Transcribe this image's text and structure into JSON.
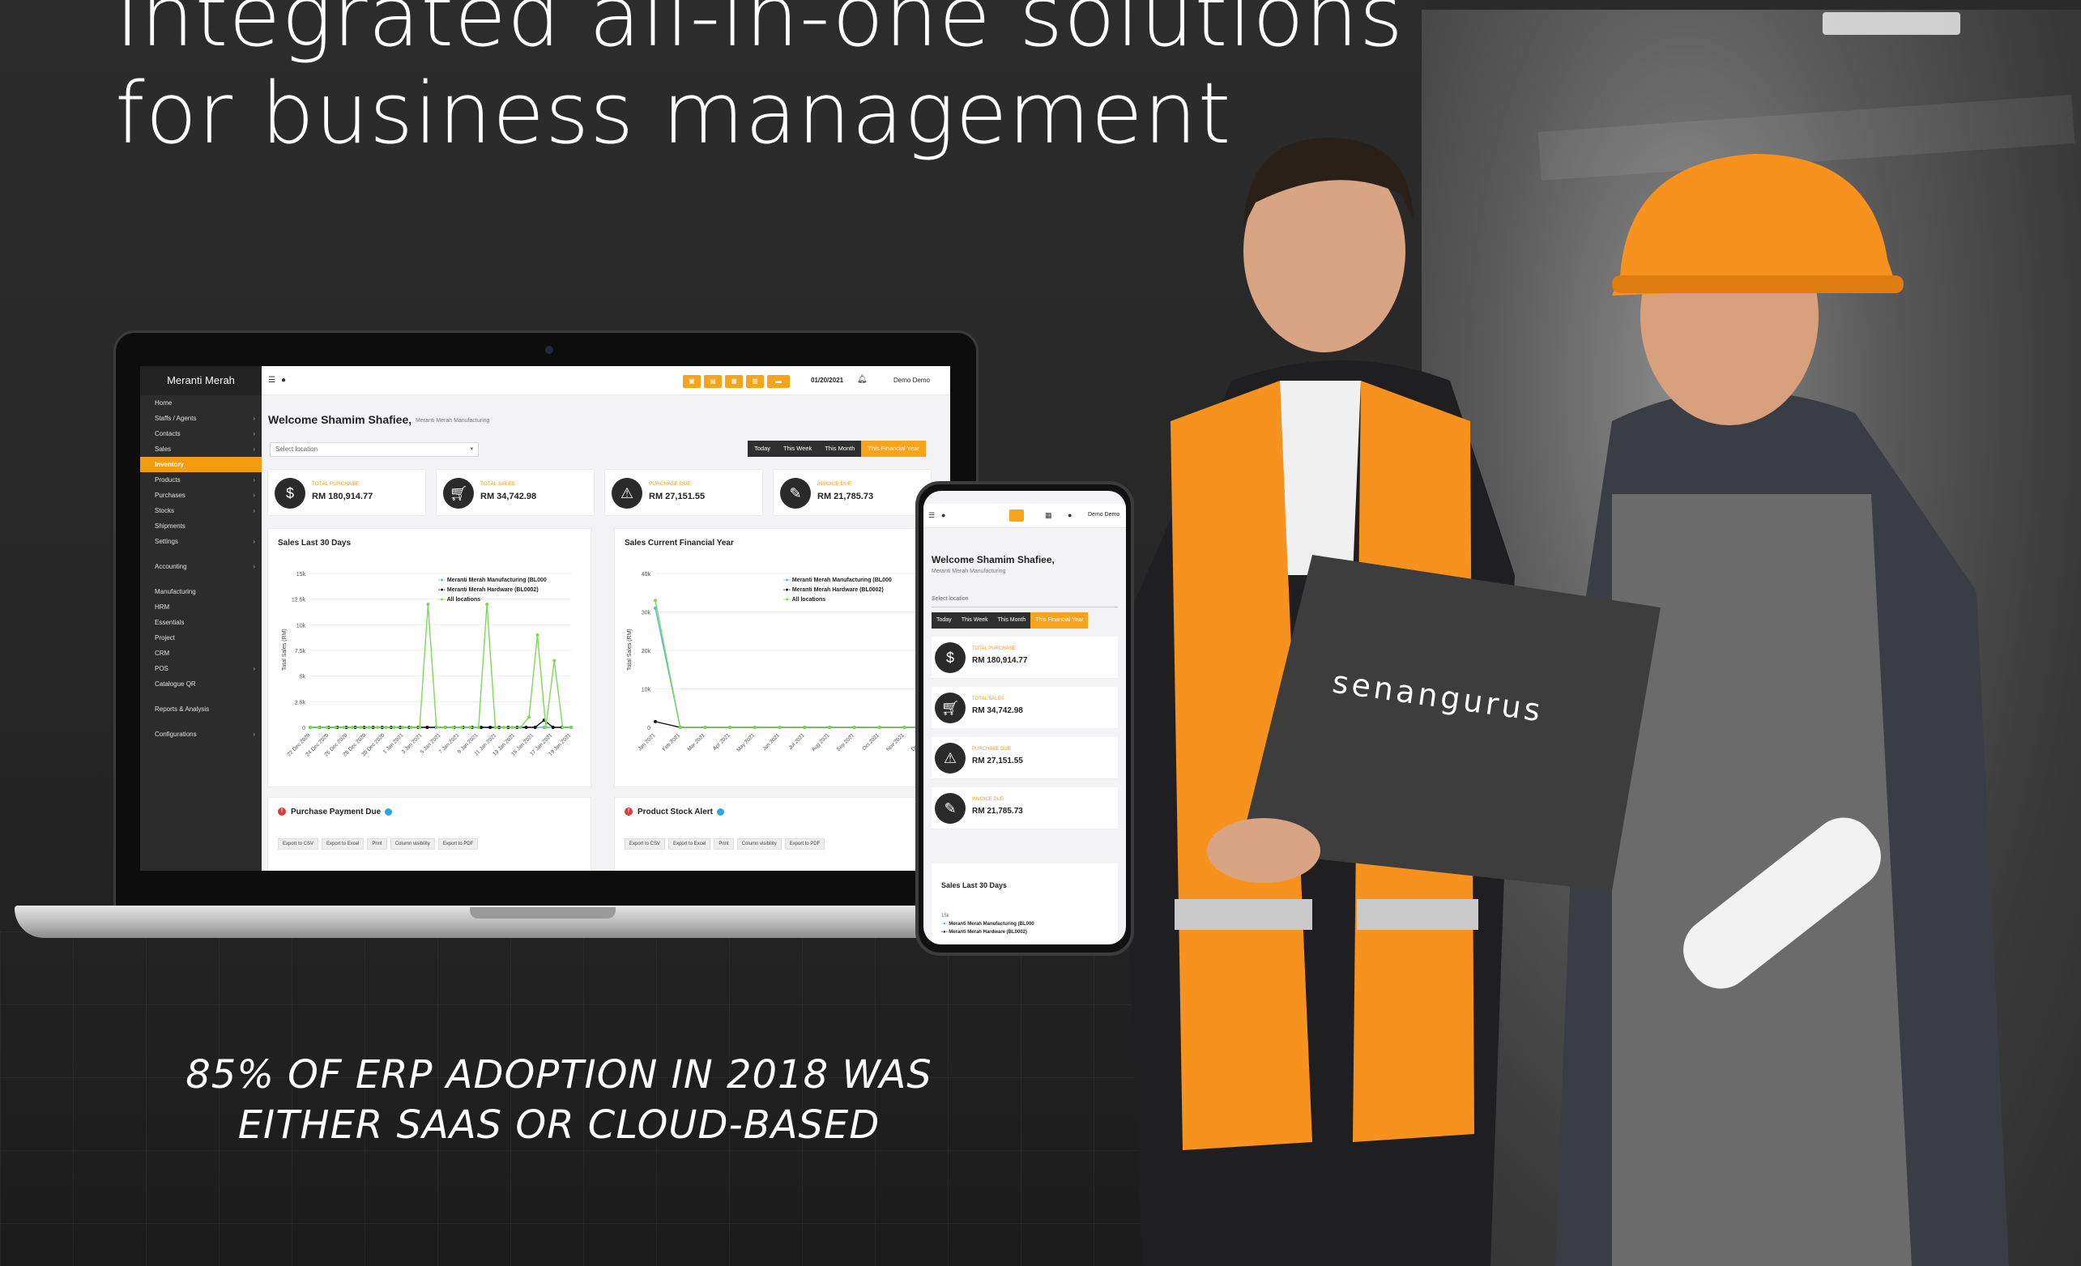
{
  "headline": {
    "line1": "Integrated all-in-one solutions",
    "line2": "for business management"
  },
  "stat": {
    "line1": "85% OF ERP ADOPTION IN 2018 WAS",
    "line2": "EITHER SAAS OR CLOUD-BASED"
  },
  "brand_logo": "senangurus",
  "colors": {
    "accent": "#f7a31b",
    "dark": "#2c2c2c",
    "green": "#7ed957"
  },
  "desktop": {
    "sidebar": {
      "brand": "Meranti Merah",
      "items": [
        {
          "label": "Home",
          "icon": "home-icon",
          "chevron": false
        },
        {
          "label": "Staffs / Agents",
          "icon": "users-icon",
          "chevron": true
        },
        {
          "label": "Contacts",
          "icon": "contacts-icon",
          "chevron": true
        },
        {
          "label": "Sales",
          "icon": "cart-icon",
          "chevron": true
        },
        {
          "label": "Inventory",
          "icon": "dollar-icon",
          "chevron": true,
          "active": true
        },
        {
          "label": "Products",
          "icon": "",
          "chevron": true
        },
        {
          "label": "Purchases",
          "icon": "",
          "chevron": true
        },
        {
          "label": "Stocks",
          "icon": "",
          "chevron": true
        },
        {
          "label": "Shipments",
          "icon": "",
          "chevron": false
        },
        {
          "label": "Settings",
          "icon": "",
          "chevron": true
        },
        {
          "label": "Accounting",
          "icon": "ledger-icon",
          "chevron": true
        },
        {
          "label": "Manufacturing",
          "icon": "gear-icon",
          "chevron": false
        },
        {
          "label": "HRM",
          "icon": "users-icon",
          "chevron": false
        },
        {
          "label": "Essentials",
          "icon": "chat-icon",
          "chevron": false
        },
        {
          "label": "Project",
          "icon": "folder-icon",
          "chevron": false
        },
        {
          "label": "CRM",
          "icon": "globe-icon",
          "chevron": false
        },
        {
          "label": "POS",
          "icon": "chat-icon",
          "chevron": true
        },
        {
          "label": "Catalogue QR",
          "icon": "grid-icon",
          "chevron": false
        },
        {
          "label": "Reports & Analysis",
          "icon": "chart-icon",
          "chevron": false
        },
        {
          "label": "Configurations",
          "icon": "gear-icon",
          "chevron": true
        }
      ]
    },
    "topbar": {
      "date": "01/20/2021",
      "user": "Demo Demo"
    },
    "welcome": "Welcome Shamim Shafiee,",
    "welcome_sub": "Meranti Merah Manufacturing",
    "location_placeholder": "Select location",
    "periods": [
      "Today",
      "This Week",
      "This Month",
      "This Financial Year"
    ],
    "kpis": [
      {
        "label": "TOTAL PURCHASE",
        "value": "RM 180,914.77",
        "icon": "$"
      },
      {
        "label": "TOTAL SALES",
        "value": "RM 34,742.98",
        "icon": "cart"
      },
      {
        "label": "PURCHASE DUE",
        "value": "RM 27,151.55",
        "icon": "!"
      },
      {
        "label": "INVOICE DUE",
        "value": "RM 21,785.73",
        "icon": "clip"
      }
    ],
    "panels": {
      "sales30": "Sales Last 30 Days",
      "salesfy": "Sales Current Financial Year",
      "purchase_due": "Purchase Payment Due",
      "stock_alert": "Product Stock Alert",
      "export_buttons": [
        "Export to CSV",
        "Export to Excel",
        "Print",
        "Column visibility",
        "Export to PDF"
      ]
    },
    "legend": [
      "Meranti Merah Manufacturing (BL000",
      "Meranti Merah Hardware (BL0002)",
      "All locations"
    ]
  },
  "mobile": {
    "user": "Demo Demo",
    "welcome": "Welcome Shamim Shafiee,",
    "welcome_sub": "Meranti Merah Manufacturing",
    "location_placeholder": "Select location",
    "periods": [
      "Today",
      "This Week",
      "This Month",
      "This Financial Year"
    ],
    "chart_title": "Sales Last 30 Days",
    "chart_tick_top": "15k",
    "legend": [
      "Meranti Merah Manufacturing (BL000",
      "Meranti Merah Hardware (BL0002)"
    ]
  },
  "chart_data": [
    {
      "type": "line",
      "title": "Sales Last 30 Days",
      "ylabel": "Total Sales (RM)",
      "ylim": [
        0,
        15000
      ],
      "yticks": [
        "0",
        "2.5k",
        "5k",
        "7.5k",
        "10k",
        "12.5k",
        "15k"
      ],
      "x": [
        "22 Dec 2020",
        "24 Dec 2020",
        "26 Dec 2020",
        "28 Dec 2020",
        "30 Dec 2020",
        "1 Jan 2021",
        "3 Jan 2021",
        "5 Jan 2021",
        "7 Jan 2021",
        "9 Jan 2021",
        "11 Jan 2021",
        "13 Jan 2021",
        "15 Jan 2021",
        "17 Jan 2021",
        "19 Jan 2021"
      ],
      "series": [
        {
          "name": "Meranti Merah Manufacturing (BL000",
          "color": "#5fb3e8",
          "values": [
            0,
            0,
            0,
            0,
            0,
            0,
            0,
            0,
            0,
            0,
            0,
            0,
            0,
            0,
            0,
            0,
            0,
            0,
            0,
            0,
            0,
            0,
            0,
            0,
            0,
            0,
            0,
            0,
            0,
            0
          ]
        },
        {
          "name": "Meranti Merah Hardware (BL0002)",
          "color": "#111111",
          "values": [
            0,
            0,
            0,
            0,
            0,
            0,
            0,
            0,
            0,
            0,
            0,
            0,
            0,
            0,
            0,
            0,
            0,
            0,
            0,
            0,
            0,
            0,
            0,
            0,
            0,
            0,
            700,
            0,
            0,
            0
          ]
        },
        {
          "name": "All locations",
          "color": "#7ed957",
          "values": [
            0,
            0,
            0,
            0,
            0,
            0,
            0,
            0,
            0,
            0,
            0,
            0,
            0,
            0,
            12000,
            0,
            0,
            0,
            0,
            0,
            0,
            12000,
            0,
            0,
            0,
            0,
            1000,
            9000,
            0,
            6500,
            0,
            0
          ]
        }
      ]
    },
    {
      "type": "line",
      "title": "Sales Current Financial Year",
      "ylabel": "Total Sales (RM)",
      "ylim": [
        0,
        40000
      ],
      "yticks": [
        "0",
        "10k",
        "20k",
        "30k",
        "40k"
      ],
      "x": [
        "Jan 2021",
        "Feb 2021",
        "Mar 2021",
        "Apr 2021",
        "May 2021",
        "Jun 2021",
        "Jul 2021",
        "Aug 2021",
        "Sep 2021",
        "Oct 2021",
        "Nov 2021",
        "Dec 2021"
      ],
      "series": [
        {
          "name": "Meranti Merah Manufacturing (BL000",
          "color": "#5fb3e8",
          "values": [
            31000,
            0,
            0,
            0,
            0,
            0,
            0,
            0,
            0,
            0,
            0,
            0
          ]
        },
        {
          "name": "Meranti Merah Hardware (BL0002)",
          "color": "#111111",
          "values": [
            1500,
            0,
            0,
            0,
            0,
            0,
            0,
            0,
            0,
            0,
            0,
            0
          ]
        },
        {
          "name": "All locations",
          "color": "#7ed957",
          "values": [
            33000,
            0,
            0,
            0,
            0,
            0,
            0,
            0,
            0,
            0,
            0,
            0
          ]
        }
      ]
    }
  ]
}
